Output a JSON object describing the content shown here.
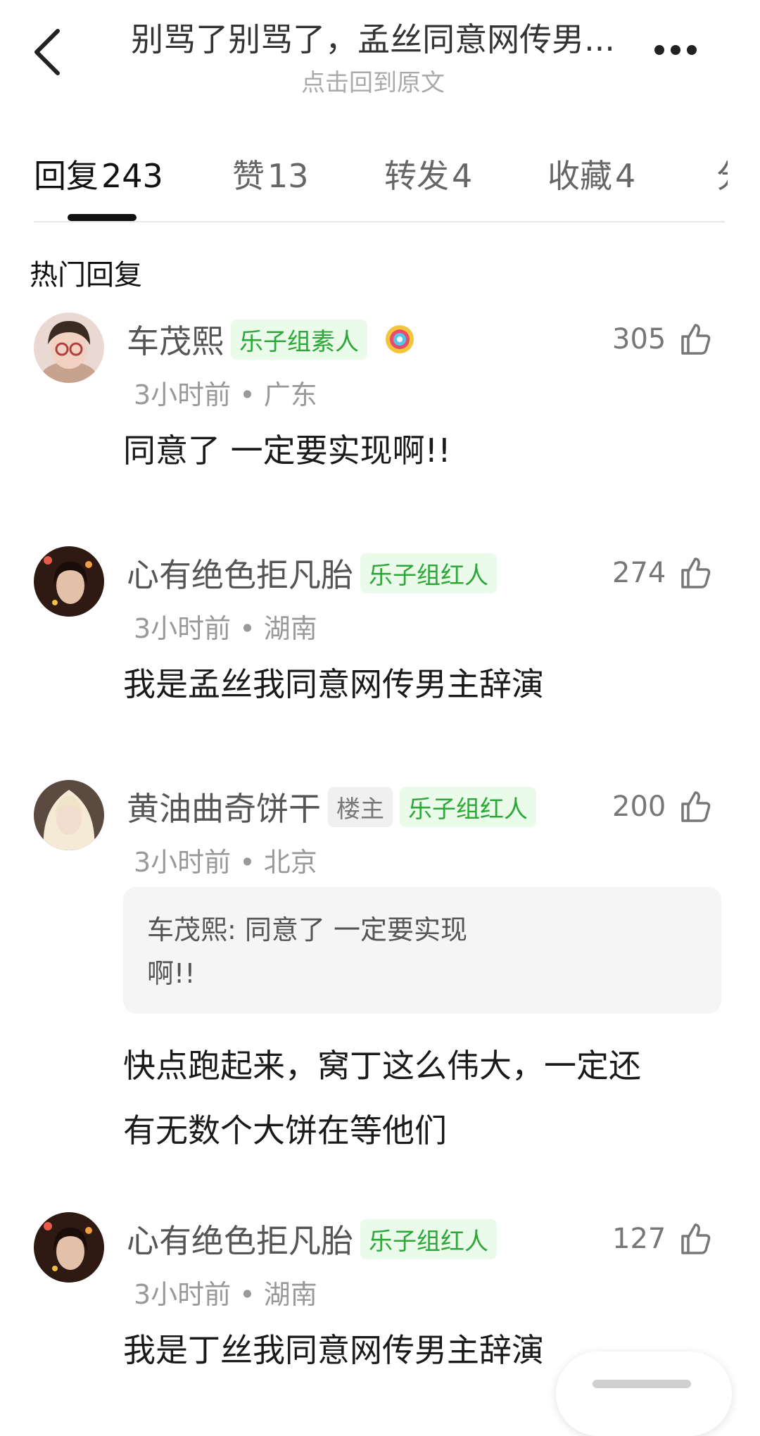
{
  "header": {
    "title": "别骂了别骂了，孟丝同意网传男...",
    "subtitle": "点击回到原文"
  },
  "tabs": [
    {
      "label": "回复",
      "count": "243"
    },
    {
      "label": "赞",
      "count": "13"
    },
    {
      "label": "转发",
      "count": "4"
    },
    {
      "label": "收藏",
      "count": "4"
    }
  ],
  "section_title": "热门回复",
  "comments": [
    {
      "user": "车茂熙",
      "badges": [
        "乐子组素人"
      ],
      "likes": "305",
      "time": "3小时前",
      "location": "广东",
      "text": "同意了 一定要实现啊!!"
    },
    {
      "user": "心有绝色拒凡胎",
      "badges": [
        "乐子组红人"
      ],
      "likes": "274",
      "time": "3小时前",
      "location": "湖南",
      "text": "我是孟丝我同意网传男主辞演"
    },
    {
      "user": "黄油曲奇饼干",
      "owner_badge": "楼主",
      "badges": [
        "乐子组红人"
      ],
      "likes": "200",
      "time": "3小时前",
      "location": "北京",
      "quote_line1": "车茂熙: 同意了 一定要实现",
      "quote_line2": "啊!!",
      "text_line1": "快点跑起来，窝丁这么伟大，一定还",
      "text_line2": "有无数个大饼在等他们"
    },
    {
      "user": "心有绝色拒凡胎",
      "badges": [
        "乐子组红人"
      ],
      "likes": "127",
      "time": "3小时前",
      "location": "湖南",
      "text": "我是丁丝我同意网传男主辞演"
    }
  ],
  "meta_separator": "•",
  "colors": {
    "badge_green_text": "#2ea73a",
    "badge_green_bg": "#eafbe9",
    "tab_active": "#111111"
  }
}
